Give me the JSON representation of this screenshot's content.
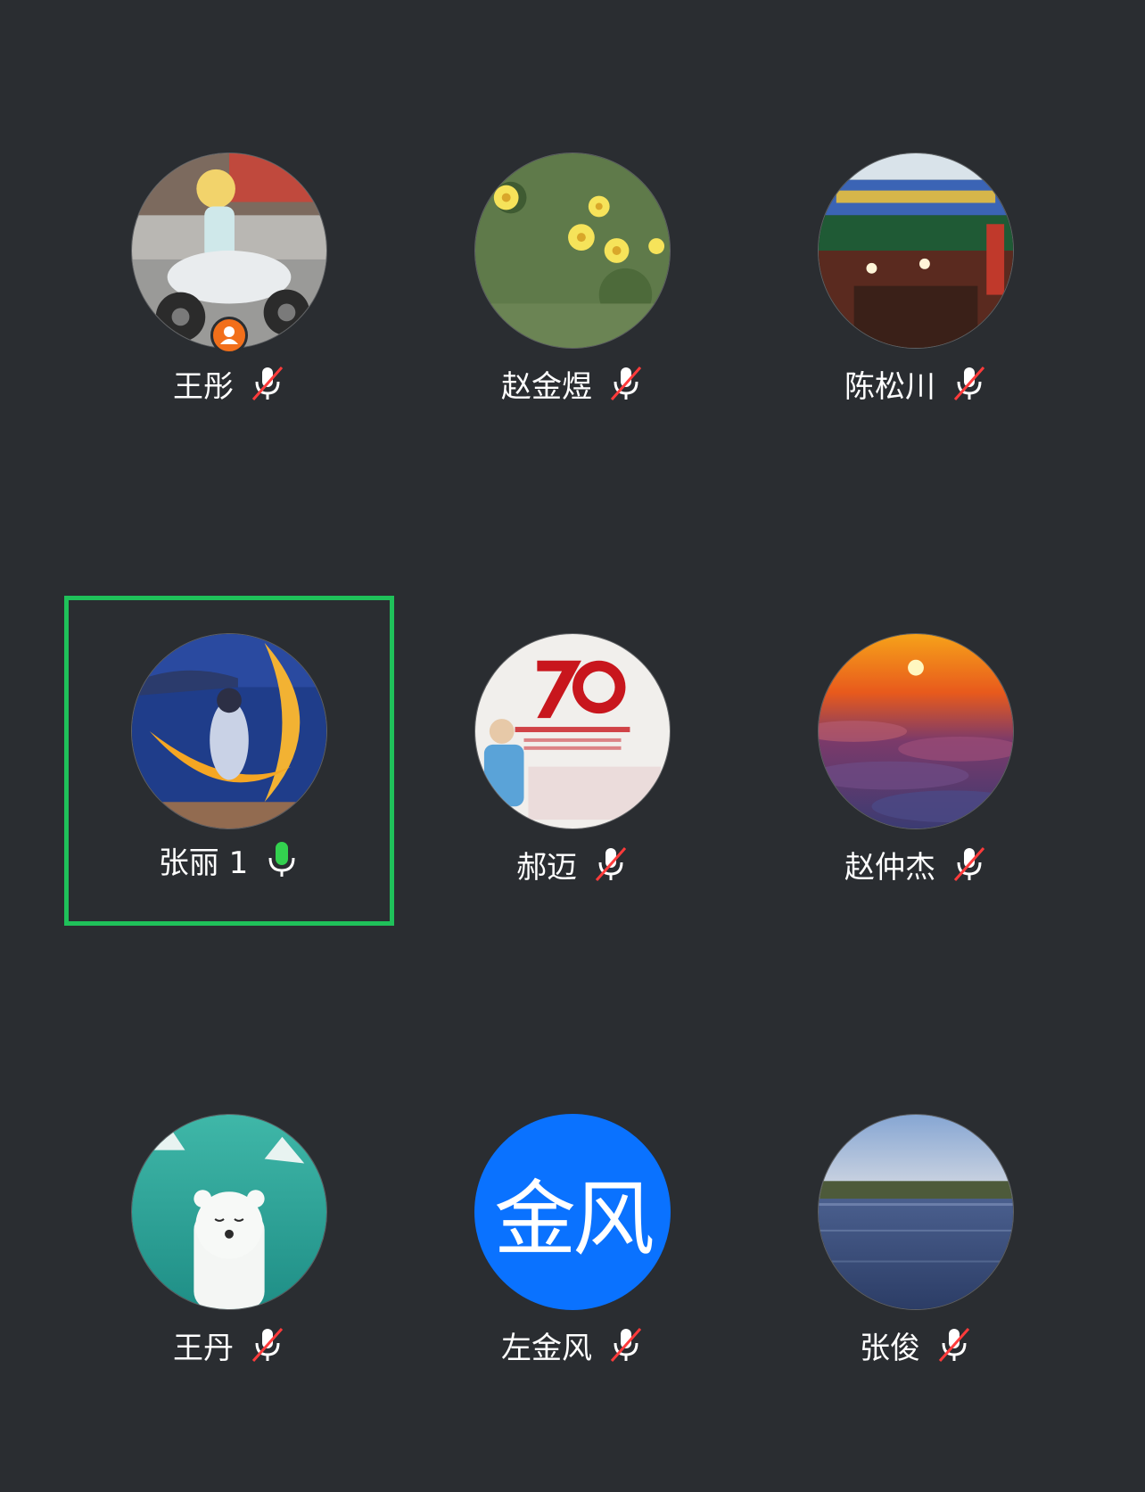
{
  "colors": {
    "background": "#2a2d31",
    "active_speaker_border": "#1fc15a",
    "mic_on": "#33d14f",
    "mic_muted_slash": "#ff3b3b",
    "text_avatar_bg": "#0a72ff",
    "host_badge": "#f26f1a"
  },
  "participants": [
    {
      "name": "王彤",
      "mic": "muted",
      "avatar_icon": "photo-child-motorbike-icon",
      "host": true,
      "active": false
    },
    {
      "name": "赵金煜",
      "mic": "muted",
      "avatar_icon": "photo-yellow-flowers-icon",
      "host": false,
      "active": false
    },
    {
      "name": "陈松川",
      "mic": "muted",
      "avatar_icon": "photo-chinese-gate-icon",
      "host": false,
      "active": false
    },
    {
      "name": "张丽 1",
      "mic": "on",
      "avatar_icon": "photo-moon-girl-icon",
      "host": false,
      "active": true
    },
    {
      "name": "郝迈",
      "mic": "muted",
      "avatar_icon": "photo-70th-anniversary-icon",
      "host": false,
      "active": false
    },
    {
      "name": "赵仲杰",
      "mic": "muted",
      "avatar_icon": "photo-sunset-clouds-icon",
      "host": false,
      "active": false
    },
    {
      "name": "王丹",
      "mic": "muted",
      "avatar_icon": "photo-polar-bear-icon",
      "host": false,
      "active": false
    },
    {
      "name": "左金风",
      "mic": "muted",
      "avatar_text": "金风",
      "host": false,
      "active": false
    },
    {
      "name": "张俊",
      "mic": "muted",
      "avatar_icon": "photo-lake-icon",
      "host": false,
      "active": false
    }
  ]
}
